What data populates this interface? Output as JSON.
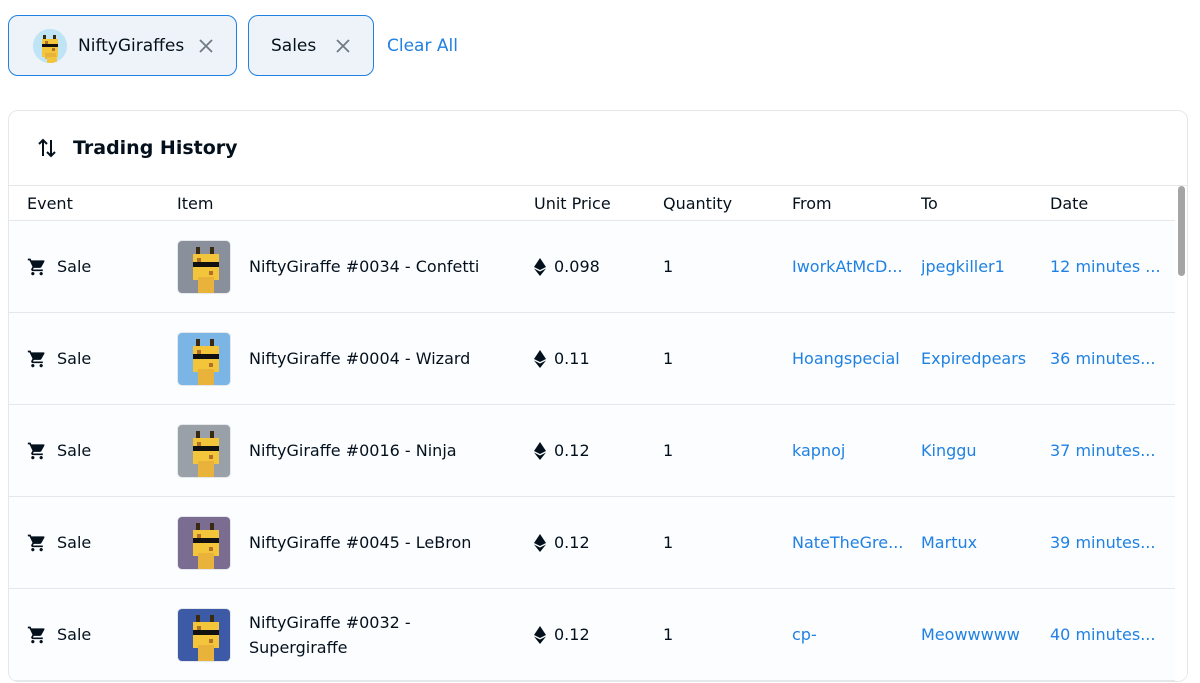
{
  "filters": {
    "chips": [
      {
        "label": "NiftyGiraffes",
        "icon": "giraffe-avatar"
      },
      {
        "label": "Sales"
      }
    ],
    "clear_all": "Clear All"
  },
  "panel": {
    "title": "Trading History",
    "icon": "swap-arrows-icon"
  },
  "table": {
    "columns": [
      "Event",
      "Item",
      "Unit Price",
      "Quantity",
      "From",
      "To",
      "Date"
    ],
    "rows": [
      {
        "event": "Sale",
        "item": "NiftyGiraffe #0034 - Confetti",
        "price": "0.098",
        "qty": "1",
        "from": "IworkAtMcD...",
        "to": "jpegkiller1",
        "date": "12 minutes ...",
        "thumb_bg": "#8a8f9c"
      },
      {
        "event": "Sale",
        "item": "NiftyGiraffe #0004 - Wizard",
        "price": "0.11",
        "qty": "1",
        "from": "Hoangspecial",
        "to": "Expiredpears",
        "date": "36 minutes...",
        "thumb_bg": "#7bb5e6"
      },
      {
        "event": "Sale",
        "item": "NiftyGiraffe #0016 - Ninja",
        "price": "0.12",
        "qty": "1",
        "from": "kapnoj",
        "to": "Kinggu",
        "date": "37 minutes...",
        "thumb_bg": "#9aa0a8"
      },
      {
        "event": "Sale",
        "item": "NiftyGiraffe #0045 - LeBron",
        "price": "0.12",
        "qty": "1",
        "from": "NateTheGre...",
        "to": "Martux",
        "date": "39 minutes...",
        "thumb_bg": "#7b6c92"
      },
      {
        "event": "Sale",
        "item": "NiftyGiraffe #0032 - Supergiraffe",
        "price": "0.12",
        "qty": "1",
        "from": "cp-",
        "to": "Meowwwww",
        "date": "40 minutes...",
        "thumb_bg": "#3c5aa6"
      }
    ]
  },
  "colors": {
    "accent": "#2081e2",
    "pill_bg": "#edf3f8",
    "border": "#e5e8eb"
  }
}
